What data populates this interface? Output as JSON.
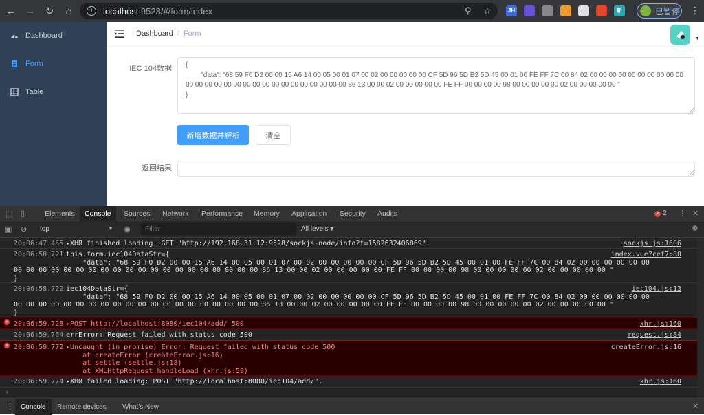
{
  "browser": {
    "url_host": "localhost",
    "url_rest": ":9528/#/form/index",
    "pause_label": "已暂停",
    "extensions": [
      {
        "name": "jh-ext",
        "text": "JH",
        "color": "#3d6ee8"
      },
      {
        "name": "extension-2",
        "text": "",
        "color": "#6a4fd8"
      },
      {
        "name": "extension-3",
        "text": "",
        "color": "#888888"
      },
      {
        "name": "extension-4",
        "text": "",
        "color": "#f29b2c"
      },
      {
        "name": "qr-extension",
        "text": "",
        "color": "#e0e0e0"
      },
      {
        "name": "extension-6",
        "text": "",
        "color": "#e8452e"
      },
      {
        "name": "extension-7",
        "text": "新",
        "color": "#2aa5b5"
      }
    ]
  },
  "sidebar": {
    "items": [
      {
        "label": "Dashboard",
        "icon": "dashboard-icon"
      },
      {
        "label": "Form",
        "icon": "form-icon"
      },
      {
        "label": "Table",
        "icon": "table-icon"
      }
    ],
    "active_index": 1
  },
  "breadcrumb": {
    "home": "Dashboard",
    "sep": "/",
    "current": "Form"
  },
  "form": {
    "label_data": "IEC 104数据",
    "textarea_value": "{\n        \"data\": \"68 59 F0 D2 00 00 15 A6 14 00 05 00 01 07 00 02 00 00 00 00 00 CF 5D 96 5D B2 5D 45 00 01 00 FE FF 7C 00 84 02 00 00 00 00 00 00 00 00 00 00 00 00 00 00 00 00 00 00 00 00 00 00 00 00 00 00 00 86 13 00 00 02 00 00 00 00 00 FE FF 00 00 00 00 98 00 00 00 00 00 02 00 00 00 00 00 \"\n}",
    "parse_button": "新增数据并解析",
    "clear_button": "清空",
    "label_result": "返回结果",
    "result_value": ""
  },
  "devtools": {
    "tabs": [
      "Elements",
      "Console",
      "Sources",
      "Network",
      "Performance",
      "Memory",
      "Application",
      "Security",
      "Audits"
    ],
    "active_tab": "Console",
    "error_count": "2",
    "context": "top",
    "filter_placeholder": "Filter",
    "levels": "All levels",
    "drawer_tabs": [
      "Console",
      "Remote devices",
      "What's New"
    ],
    "prompt": "›"
  },
  "console": [
    {
      "ts": "20:06:47.465",
      "type": "log",
      "lines": [
        "▸XHR finished loading: GET \"http://192.168.31.12:9528/sockjs-node/info?t=1582632406869\"."
      ],
      "src": "sockjs.js:1606"
    },
    {
      "ts": "20:06:58.721",
      "type": "log",
      "lines": [
        "this.form.iec104DataStr={",
        "    \"data\": \"68 59 F0 D2 00 00 15 A6 14 00 05 00 01 07 00 02 00 00 00 00 00 CF 5D 96 5D B2 5D 45 00 01 00 FE FF 7C 00 84 02 00 00 00 00 00 00",
        "00 00 00 00 00 00 00 00 00 00 00 00 00 00 00 00 00 00 00 00 86 13 00 00 02 00 00 00 00 00 FE FF 00 00 00 00 98 00 00 00 00 00 02 00 00 00 00 00 \"",
        "}"
      ],
      "src": "index.vue?cef7:80"
    },
    {
      "ts": "20:06:58.722",
      "type": "log",
      "lines": [
        "iec104DataStr={",
        "    \"data\": \"68 59 F0 D2 00 00 15 A6 14 00 05 00 01 07 00 02 00 00 00 00 00 CF 5D 96 5D B2 5D 45 00 01 00 FE FF 7C 00 84 02 00 00 00 00 00 00",
        "00 00 00 00 00 00 00 00 00 00 00 00 00 00 00 00 00 00 00 00 86 13 00 00 02 00 00 00 00 00 FE FF 00 00 00 00 98 00 00 00 00 00 02 00 00 00 00 00 \"",
        "}"
      ],
      "src": "iec104.js:13"
    },
    {
      "ts": "20:06:59.728",
      "type": "error",
      "lines": [
        "▸POST http://localhost:8080/iec104/add/ 500"
      ],
      "src": "xhr.js:160"
    },
    {
      "ts": "20:06:59.764",
      "type": "log",
      "lines": [
        "errError: Request failed with status code 500"
      ],
      "src": "request.js:84"
    },
    {
      "ts": "20:06:59.772",
      "type": "error",
      "lines": [
        "▸Uncaught (in promise) Error: Request failed with status code 500",
        "    at createError (createError.js:16)",
        "    at settle (settle.js:18)",
        "    at XMLHttpRequest.handleLoad (xhr.js:59)"
      ],
      "src": "createError.js:16"
    },
    {
      "ts": "20:06:59.774",
      "type": "log",
      "lines": [
        "▸XHR failed loading: POST \"http://localhost:8080/iec104/add/\"."
      ],
      "src": "xhr.js:160"
    }
  ]
}
